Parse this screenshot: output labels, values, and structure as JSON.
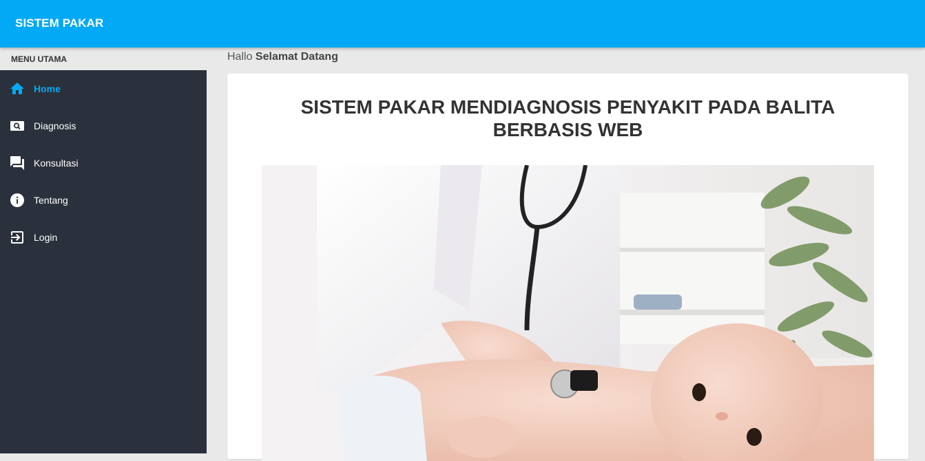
{
  "header": {
    "brand": "SISTEM PAKAR"
  },
  "sidebar": {
    "menu_title": "MENU UTAMA",
    "items": [
      {
        "label": "Home",
        "icon": "home-icon",
        "active": true
      },
      {
        "label": "Diagnosis",
        "icon": "search-icon",
        "active": false
      },
      {
        "label": "Konsultasi",
        "icon": "forum-icon",
        "active": false
      },
      {
        "label": "Tentang",
        "icon": "info-icon",
        "active": false
      },
      {
        "label": "Login",
        "icon": "login-icon",
        "active": false
      }
    ]
  },
  "main": {
    "greeting_prefix": "Hallo",
    "greeting_name": "Selamat Datang",
    "title_line1": "SISTEM PAKAR MENDIAGNOSIS PENYAKIT PADA BALITA",
    "title_line2": "BERBASIS WEB",
    "image": "doctor-examining-baby-photo"
  },
  "colors": {
    "accent": "#03a9f4",
    "sidebar_bg": "#2a313c",
    "page_bg": "#e9e9e9"
  }
}
